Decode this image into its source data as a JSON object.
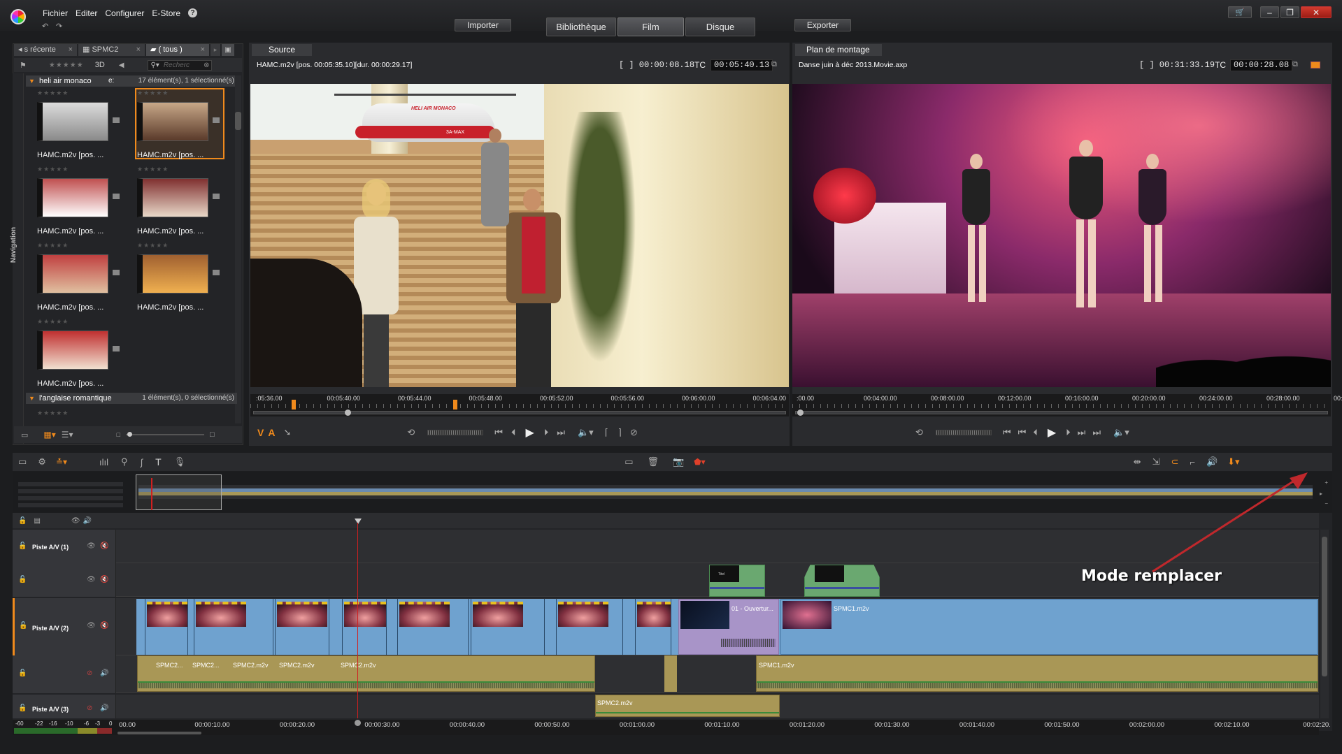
{
  "menu": {
    "items": [
      "Fichier",
      "Editer",
      "Configurer",
      "E-Store"
    ],
    "help": "?"
  },
  "toolbar": {
    "import_label": "Importer",
    "export_label": "Exporter",
    "tabs": [
      "Bibliothèque",
      "Film",
      "Disque"
    ],
    "active_tab": "Film"
  },
  "window": {
    "cart_icon": "cart-icon",
    "minimize": "–",
    "restore": "❐",
    "close": "✕"
  },
  "library": {
    "tabs": [
      "s récente",
      "SPMC2",
      "( tous )"
    ],
    "filter_label": "3D",
    "search_placeholder": "Recherc",
    "nav_label": "Navigation",
    "group1": {
      "name": "heli air monaco",
      "col": "e:",
      "count": "17 élément(s), 1 sélectionné(s)"
    },
    "items": [
      "HAMC.m2v [pos. ...",
      "HAMC.m2v [pos. ...",
      "HAMC.m2v [pos. ...",
      "HAMC.m2v [pos. ...",
      "HAMC.m2v [pos. ...",
      "HAMC.m2v [pos. ...",
      "HAMC.m2v [pos. ..."
    ],
    "group2": {
      "name": "l'anglaise romantique",
      "count": "1 élément(s), 0 sélectionné(s)"
    }
  },
  "source": {
    "tab": "Source",
    "clip_info": "HAMC.m2v [pos. 00:05:35.10][dur. 00:00:29.17]",
    "duration": "[ ] 00:00:08.18",
    "tc_label": "TC",
    "timecode": "00:05:40.13",
    "ruler": [
      ":05:36.00",
      "00:05:40.00",
      "00:05:44.00",
      "00:05:48.00",
      "00:05:52.00",
      "00:05:56.00",
      "00:06:00.00",
      "00:06:04.00"
    ],
    "va_v": "V",
    "va_a": "A",
    "scene": {
      "helicopter_text": "HELI AIR MONACO",
      "reg": "3A-MAX"
    }
  },
  "program": {
    "tab": "Plan de montage",
    "project": "Danse juin à déc 2013.Movie.axp",
    "duration": "[ ] 00:31:33.19",
    "tc_label": "TC",
    "timecode": "00:00:28.08",
    "ruler": [
      ":00.00",
      "00:04:00.00",
      "00:08:00.00",
      "00:12:00.00",
      "00:16:00.00",
      "00:20:00.00",
      "00:24:00.00",
      "00:28:00.00",
      "00:"
    ]
  },
  "timeline": {
    "tracks": [
      "Piste A/V (1)",
      "Piste A/V (2)",
      "Piste A/V (3)"
    ],
    "ruler": [
      "00.00",
      "00:00:10.00",
      "00:00:20.00",
      "00:00:30.00",
      "00:00:40.00",
      "00:00:50.00",
      "00:01:00.00",
      "00:01:10.00",
      "00:01:20.00",
      "00:01:30.00",
      "00:01:40.00",
      "00:01:50.00",
      "00:02:00.00",
      "00:02:10.00",
      "00:02:20."
    ],
    "meter": [
      "-60",
      "-22",
      "-16",
      "-10",
      "-6",
      "-3",
      "0"
    ],
    "clips": {
      "ouverture": "01 - Ouvertur...",
      "spmc1": "SPMC1.m2v",
      "a_spmc2_1": "SPMC2...",
      "a_spmc2_2": "SPMC2...",
      "a_spmc2_3": "SPMC2.m2v",
      "a_spmc2_4": "SPMC2.m2v",
      "a_spmc2_5": "SPMC2.m2v",
      "a_spmc1": "SPMC1.m2v",
      "t3_spmc2": "SPMC2.m2v"
    },
    "title_thumb": "Titel"
  },
  "annotation": {
    "text": "Mode remplacer",
    "color": "#c0282c"
  },
  "colors": {
    "accent": "#f08a1c",
    "video_track": "#6fa2cf",
    "audio_track": "#a99756",
    "playhead": "#d02020"
  }
}
